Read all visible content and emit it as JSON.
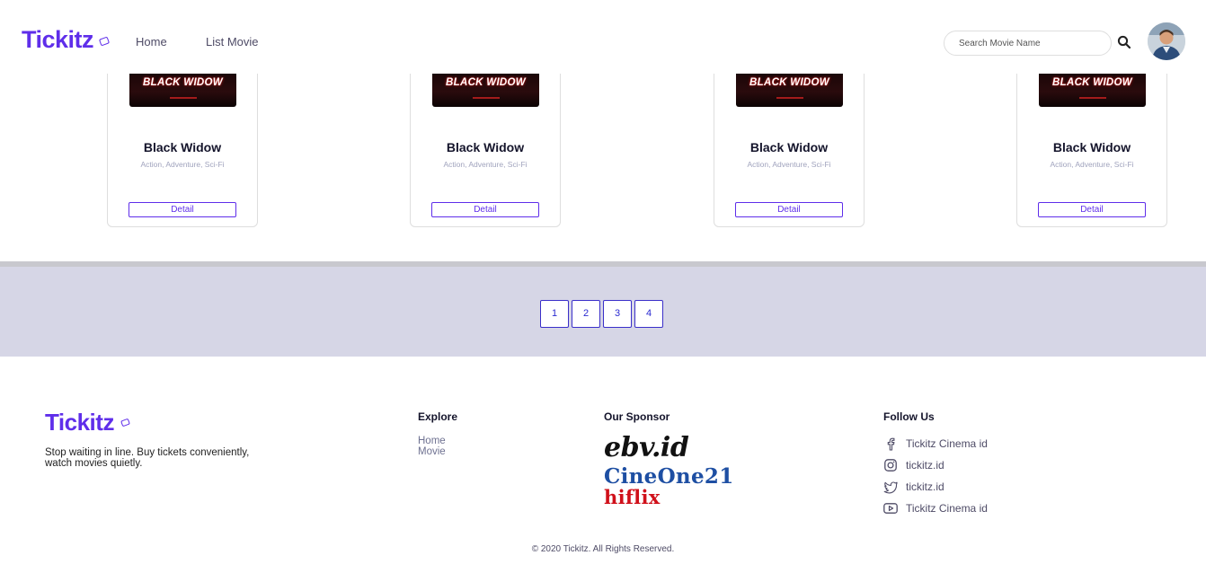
{
  "header": {
    "logo": "Tickitz",
    "nav": [
      {
        "label": "Home"
      },
      {
        "label": "List Movie"
      }
    ],
    "search": {
      "placeholder": "Search Movie Name",
      "value": ""
    },
    "search_icon": "search-icon",
    "avatar": "user-avatar"
  },
  "movies": [
    {
      "poster_text": "BLACK WIDOW",
      "title": "Black Widow",
      "genre": "Action, Adventure, Sci-Fi",
      "button": "Detail"
    },
    {
      "poster_text": "BLACK WIDOW",
      "title": "Black Widow",
      "genre": "Action, Adventure, Sci-Fi",
      "button": "Detail"
    },
    {
      "poster_text": "BLACK WIDOW",
      "title": "Black Widow",
      "genre": "Action, Adventure, Sci-Fi",
      "button": "Detail"
    },
    {
      "poster_text": "BLACK WIDOW",
      "title": "Black Widow",
      "genre": "Action, Adventure, Sci-Fi",
      "button": "Detail"
    }
  ],
  "pagination": [
    "1",
    "2",
    "3",
    "4"
  ],
  "footer": {
    "logo": "Tickitz",
    "tagline": "Stop waiting in line. Buy tickets conveniently, watch movies quietly.",
    "explore": {
      "heading": "Explore",
      "links": [
        "Home",
        "Movie"
      ]
    },
    "sponsor": {
      "heading": "Our Sponsor",
      "items": [
        "ebv.id",
        "CineOne21",
        "hiflix"
      ]
    },
    "follow": {
      "heading": "Follow Us",
      "items": [
        {
          "icon": "facebook-icon",
          "label": "Tickitz Cinema id"
        },
        {
          "icon": "instagram-icon",
          "label": "tickitz.id"
        },
        {
          "icon": "twitter-icon",
          "label": "tickitz.id"
        },
        {
          "icon": "youtube-icon",
          "label": "Tickitz Cinema id"
        }
      ]
    },
    "copyright": "© 2020 Tickitz. All Rights Reserved."
  },
  "colors": {
    "brand": "#5F2EEA",
    "pagination_band": "#D6D6E6",
    "page_button_border": "#3A2FC9",
    "ebv": "#111111",
    "cineone": "#1E4FA3",
    "hiflix": "#D0101A"
  }
}
